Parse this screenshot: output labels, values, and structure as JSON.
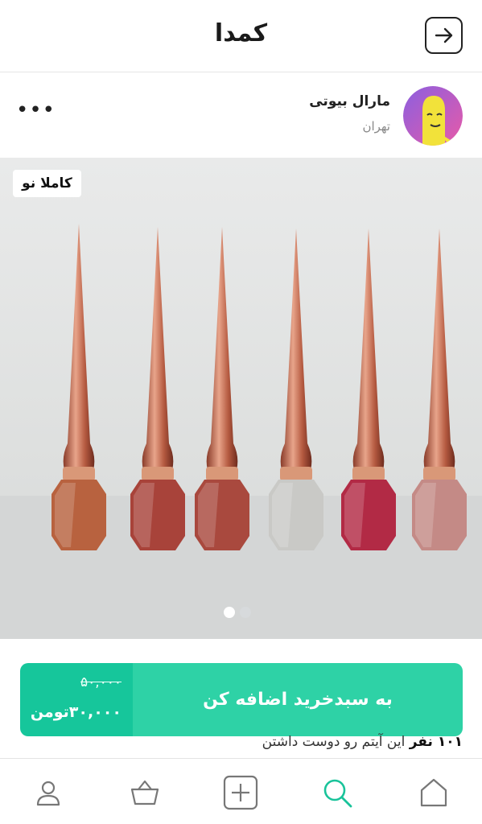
{
  "header": {
    "logo": "کمدا",
    "back_icon": "arrow-right-icon"
  },
  "seller": {
    "name": "مارال بیوتی",
    "city": "تهران",
    "more_label": "•••"
  },
  "product": {
    "badge": "کاملا نو",
    "slide_count": 2,
    "active_slide": 1
  },
  "cart": {
    "old_price": "۵۰,۰۰۰",
    "new_price": "۳۰,۰۰۰تومن",
    "add_label": "به سبدخرید اضافه کن"
  },
  "likes": {
    "count": "۱۰۱ نفر",
    "text": "این آیتم رو دوست داشتن"
  },
  "bottom_nav": [
    {
      "name": "profile",
      "icon": "user-icon"
    },
    {
      "name": "basket",
      "icon": "basket-icon"
    },
    {
      "name": "add",
      "icon": "plus-square-icon"
    },
    {
      "name": "search",
      "icon": "search-icon",
      "active": true
    },
    {
      "name": "home",
      "icon": "home-icon"
    }
  ],
  "colors": {
    "accent": "#2ed2a6",
    "accent_dark": "#16c69b",
    "active_nav": "#19c39a"
  }
}
